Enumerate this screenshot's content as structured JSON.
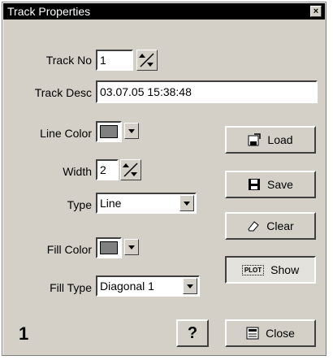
{
  "window": {
    "title": "Track Properties"
  },
  "form": {
    "track_no": {
      "label": "Track No",
      "value": "1"
    },
    "track_desc": {
      "label": "Track Desc",
      "value": "03.07.05 15:38:48"
    },
    "line_color": {
      "label": "Line Color",
      "color": "#808080"
    },
    "width": {
      "label": "Width",
      "value": "2"
    },
    "type": {
      "label": "Type",
      "value": "Line"
    },
    "fill_color": {
      "label": "Fill Color",
      "color": "#808080"
    },
    "fill_type": {
      "label": "Fill Type",
      "value": "Diagonal 1"
    }
  },
  "buttons": {
    "load": "Load",
    "save": "Save",
    "clear": "Clear",
    "show": "Show",
    "show_icon_text": "PLOT",
    "help": "?",
    "close": "Close"
  },
  "status": {
    "number": "1"
  },
  "icons": [
    "close-x-icon",
    "spinner-arrows-icon",
    "dropdown-arrow-icon",
    "load-icon",
    "save-icon",
    "eraser-icon",
    "plot-icon",
    "close-doc-icon"
  ]
}
